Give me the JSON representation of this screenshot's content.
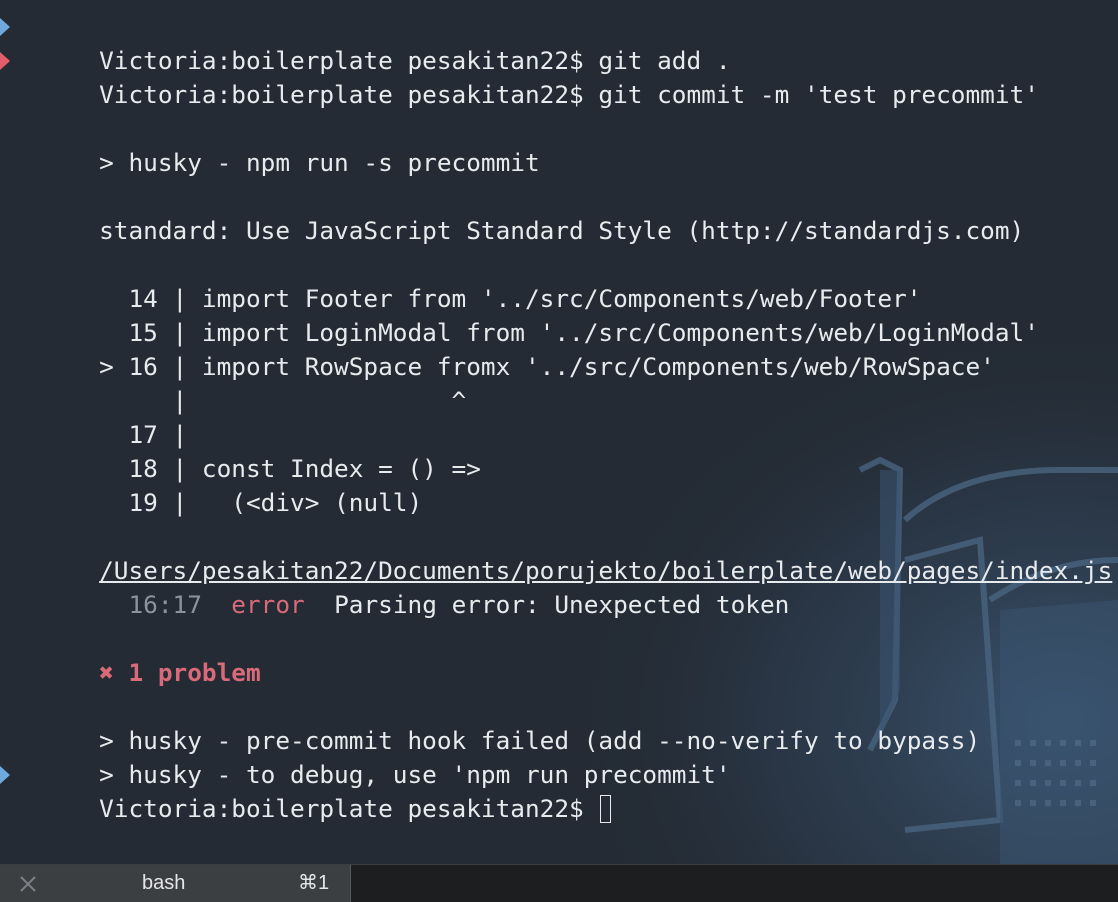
{
  "terminal": {
    "lines": {
      "l1": "Victoria:boilerplate pesakitan22$ git add .",
      "l2": "Victoria:boilerplate pesakitan22$ git commit -m 'test precommit'",
      "l3": "> husky - npm run -s precommit",
      "l4": "standard: Use JavaScript Standard Style (http://standardjs.com)",
      "l5": "  14 | import Footer from '../src/Components/web/Footer'",
      "l6": "  15 | import LoginModal from '../src/Components/web/LoginModal'",
      "l7": "> 16 | import RowSpace fromx '../src/Components/web/RowSpace'",
      "l8": "     |                  ^",
      "l9": "  17 |",
      "l10": "  18 | const Index = () =>",
      "l11": "  19 |   (<div> (null)",
      "file_path": "/Users/pesakitan22/Documents/porujekto/boilerplate/web/pages/index.js",
      "error_location": "16:17",
      "error_label": "error",
      "error_message": "Parsing error: Unexpected token",
      "problem_icon": "✖",
      "problem_text": "1 problem",
      "l13": "> husky - pre-commit hook failed (add --no-verify to bypass)",
      "l14": "> husky - to debug, use 'npm run precommit'",
      "l15": "Victoria:boilerplate pesakitan22$ "
    }
  },
  "tabbar": {
    "tab_title": "bash",
    "tab_shortcut": "⌘1"
  },
  "icons": {
    "prompt": "prompt-chevron-icon",
    "prompt_error": "prompt-error-chevron-icon",
    "close": "close-icon",
    "problem": "cross-icon"
  },
  "colors": {
    "background": "#242b34",
    "text": "#e8ebee",
    "error": "#d86a79",
    "dim": "#8b949c",
    "prompt_ok": "#6fa8dc",
    "prompt_error": "#e35d6a",
    "tabbar": "#1c1e20",
    "tab_active": "#3c3f42"
  }
}
